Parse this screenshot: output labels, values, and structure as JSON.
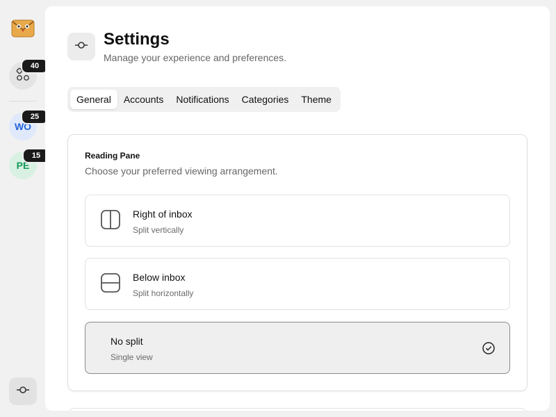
{
  "rail": {
    "all_accounts": {
      "badge": "40",
      "icon": "grid-icon"
    },
    "accounts": [
      {
        "initials": "WO",
        "badge": "25",
        "color": "#2463d8"
      },
      {
        "initials": "PE",
        "badge": "15",
        "color": "#14985a"
      }
    ],
    "settings_icon": "commit-icon"
  },
  "header": {
    "icon": "commit-icon",
    "title": "Settings",
    "subtitle": "Manage your experience and preferences."
  },
  "tabs": [
    {
      "label": "General",
      "active": true
    },
    {
      "label": "Accounts",
      "active": false
    },
    {
      "label": "Notifications",
      "active": false
    },
    {
      "label": "Categories",
      "active": false
    },
    {
      "label": "Theme",
      "active": false
    }
  ],
  "reading_pane": {
    "title": "Reading Pane",
    "description": "Choose your preferred viewing arrangement.",
    "options": [
      {
        "label": "Right of inbox",
        "sub": "Split vertically",
        "icon": "split-vertical-icon",
        "selected": false
      },
      {
        "label": "Below inbox",
        "sub": "Split horizontally",
        "icon": "split-horizontal-icon",
        "selected": false
      },
      {
        "label": "No split",
        "sub": "Single view",
        "icon": "",
        "selected": true
      }
    ]
  }
}
